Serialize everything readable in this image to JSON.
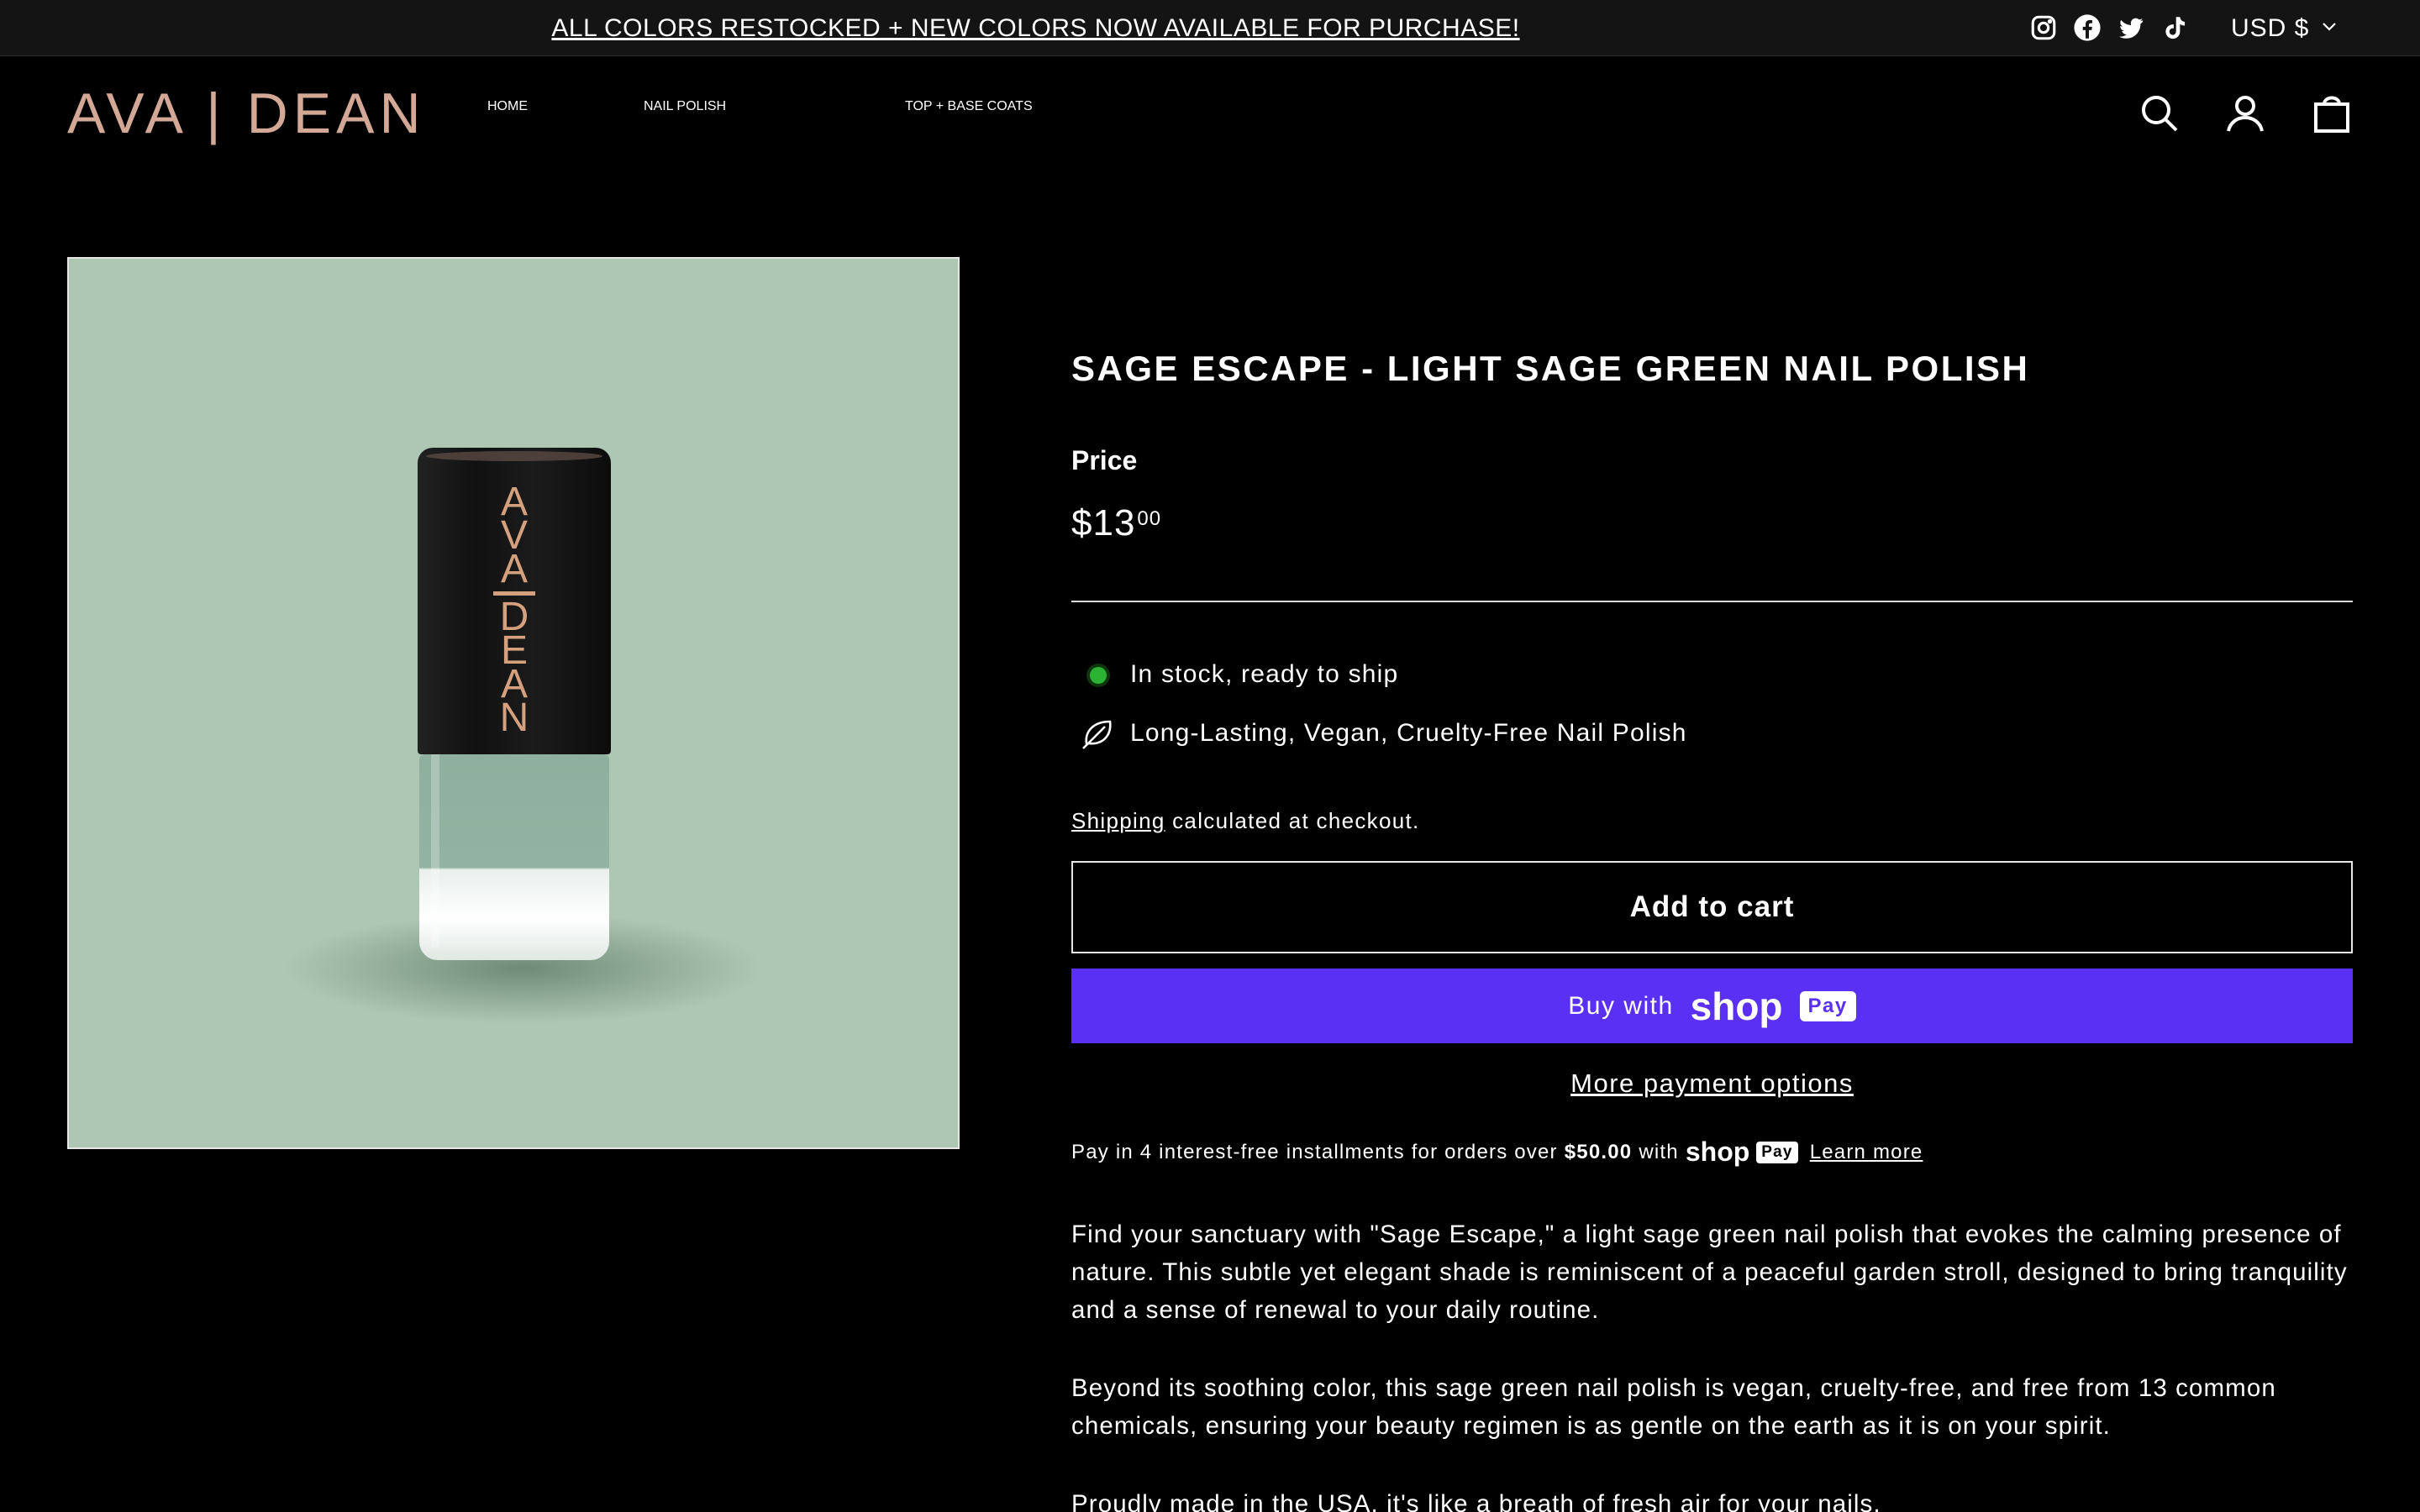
{
  "announcement": {
    "text": "ALL COLORS RESTOCKED + NEW COLORS NOW AVAILABLE FOR PURCHASE!",
    "social": [
      "instagram-icon",
      "facebook-icon",
      "twitter-icon",
      "tiktok-icon"
    ],
    "currency": "USD $"
  },
  "header": {
    "logo": "AVA | DEAN",
    "nav": [
      "HOME",
      "NAIL POLISH",
      "TOP + BASE COATS"
    ],
    "icons": [
      "search-icon",
      "account-icon",
      "cart-icon"
    ]
  },
  "product": {
    "image_alt_letters_top": [
      "A",
      "V",
      "A"
    ],
    "image_alt_letters_bottom": [
      "D",
      "E",
      "A",
      "N"
    ],
    "title": "SAGE ESCAPE - LIGHT SAGE GREEN NAIL POLISH",
    "price_label": "Price",
    "price_main": "$13",
    "price_cents": "00",
    "stock": "In stock, ready to ship",
    "feature": "Long-Lasting, Vegan, Cruelty-Free Nail Polish",
    "shipping_link": "Shipping",
    "shipping_rest": " calculated at checkout.",
    "add_to_cart": "Add to cart",
    "buy_with": "Buy with",
    "shop_word": "shop",
    "pay_word": "Pay",
    "more_payment": "More payment options",
    "installments_pre": "Pay in 4 interest-free installments for orders over",
    "installments_amount": "$50.00",
    "installments_with": "with",
    "learn_more": "Learn more",
    "desc1": "Find your sanctuary with \"Sage Escape,\" a light sage green nail polish that evokes the calming presence of nature. This subtle yet elegant shade is reminiscent of a peaceful garden stroll, designed to bring tranquility and a sense of renewal to your daily routine.",
    "desc2": "Beyond its soothing color, this sage green nail polish is vegan, cruelty-free, and free from 13 common chemicals, ensuring your beauty regimen is as gentle on the earth as it is on your spirit.",
    "desc3": "Proudly made in the USA, it's like a breath of fresh air for your nails."
  },
  "colors": {
    "logo": "#d4a896",
    "image_bg": "#aec7b4",
    "shop_pay": "#5a31f4",
    "in_stock": "#2db333"
  }
}
